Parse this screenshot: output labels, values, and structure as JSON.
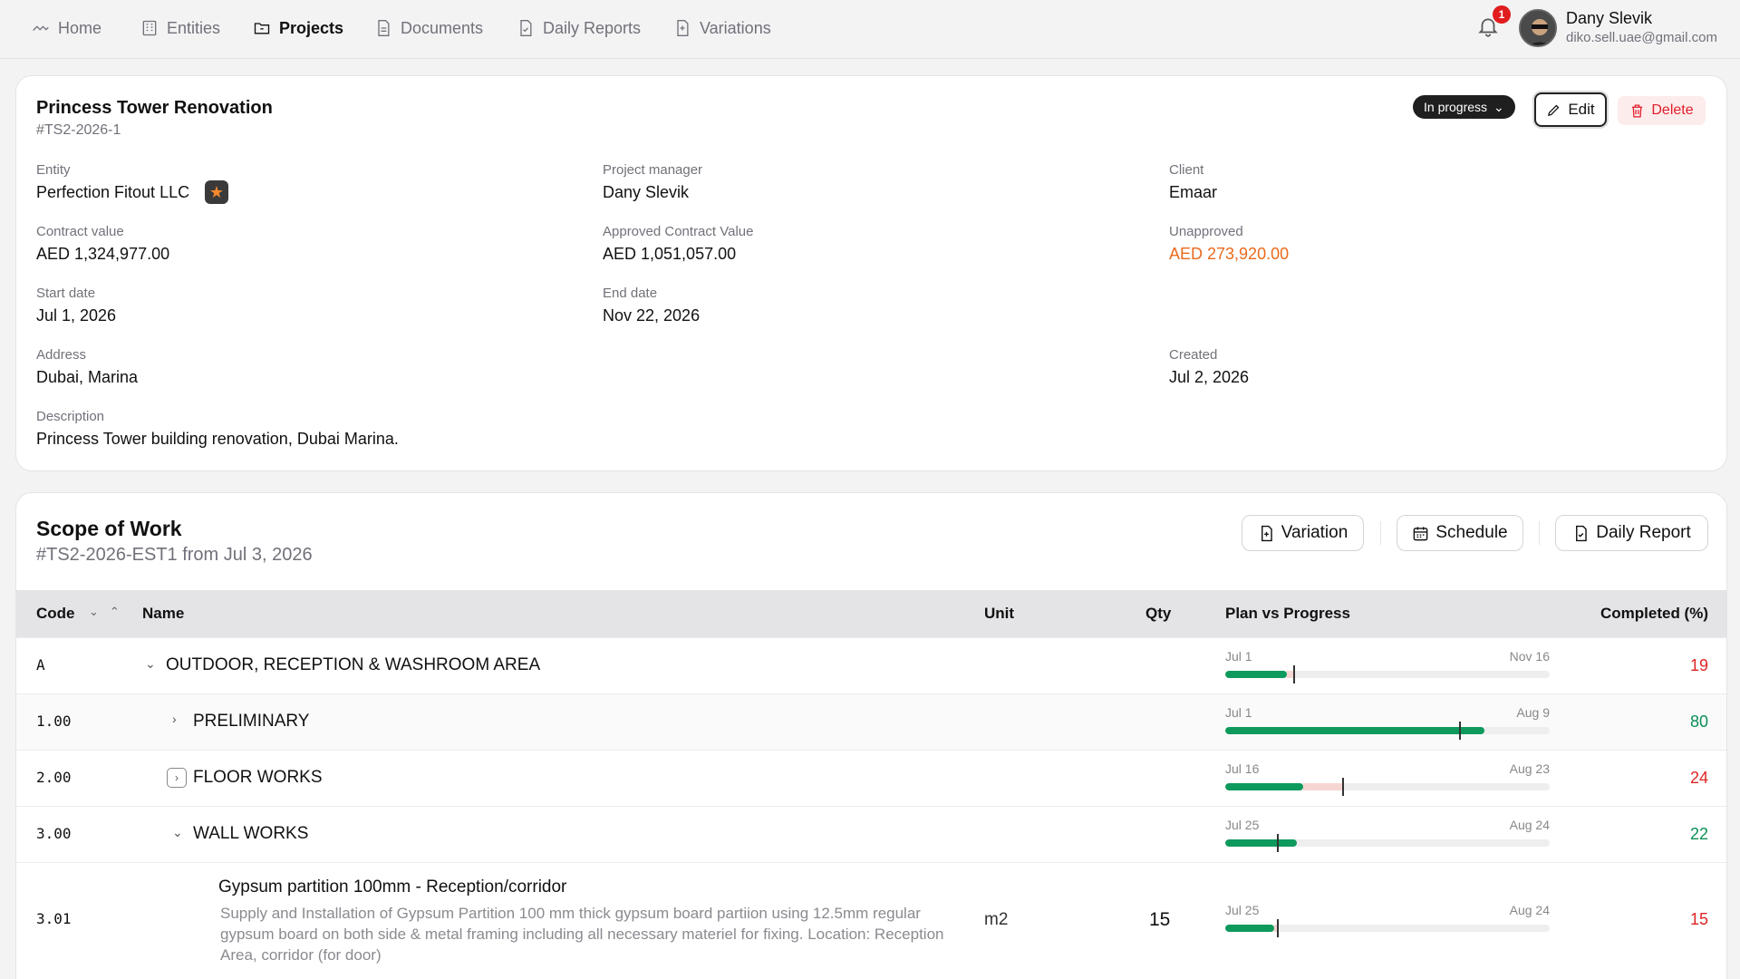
{
  "nav": {
    "items": [
      {
        "label": "Home",
        "icon": "home-icon"
      },
      {
        "label": "Entities",
        "icon": "building-icon"
      },
      {
        "label": "Projects",
        "icon": "folder-icon",
        "active": true
      },
      {
        "label": "Documents",
        "icon": "document-icon"
      },
      {
        "label": "Daily Reports",
        "icon": "report-icon"
      },
      {
        "label": "Variations",
        "icon": "variation-icon"
      }
    ],
    "notifications": "1",
    "user": {
      "name": "Dany Slevik",
      "email": "diko.sell.uae@gmail.com"
    }
  },
  "project": {
    "title": "Princess Tower Renovation",
    "code": "#TS2-2026-1",
    "status": "In progress",
    "edit_label": "Edit",
    "delete_label": "Delete",
    "fields": {
      "entity": {
        "label": "Entity",
        "value": "Perfection Fitout LLC"
      },
      "manager": {
        "label": "Project manager",
        "value": "Dany Slevik"
      },
      "client": {
        "label": "Client",
        "value": "Emaar"
      },
      "contract": {
        "label": "Contract value",
        "value": "AED 1,324,977.00"
      },
      "approved": {
        "label": "Approved Contract Value",
        "value": "AED 1,051,057.00"
      },
      "unapproved": {
        "label": "Unapproved",
        "value": "AED 273,920.00"
      },
      "start": {
        "label": "Start date",
        "value": "Jul 1, 2026"
      },
      "end": {
        "label": "End date",
        "value": "Nov 22, 2026"
      },
      "address": {
        "label": "Address",
        "value": "Dubai, Marina"
      },
      "created": {
        "label": "Created",
        "value": "Jul 2, 2026"
      },
      "description": {
        "label": "Description",
        "value": "Princess Tower building renovation, Dubai Marina."
      }
    }
  },
  "scope": {
    "title": "Scope of Work",
    "subtitle": "#TS2-2026-EST1 from Jul 3, 2026",
    "buttons": {
      "variation": "Variation",
      "schedule": "Schedule",
      "daily_report": "Daily Report"
    },
    "columns": {
      "code": "Code",
      "name": "Name",
      "unit": "Unit",
      "qty": "Qty",
      "plan": "Plan vs Progress",
      "completed": "Completed (%)"
    },
    "rows": [
      {
        "code": "A",
        "name": "OUTDOOR, RECEPTION & WASHROOM AREA",
        "start": "Jul 1",
        "end": "Nov 16",
        "progress": 0.19,
        "plan": 0.21,
        "completed": "19",
        "status": "red"
      },
      {
        "code": "1.00",
        "name": "PRELIMINARY",
        "start": "Jul 1",
        "end": "Aug 9",
        "progress": 0.8,
        "plan": 0.72,
        "completed": "80",
        "status": "green"
      },
      {
        "code": "2.00",
        "name": "FLOOR WORKS",
        "start": "Jul 16",
        "end": "Aug 23",
        "progress": 0.24,
        "plan": 0.36,
        "completed": "24",
        "status": "red"
      },
      {
        "code": "3.00",
        "name": "WALL WORKS",
        "start": "Jul 25",
        "end": "Aug 24",
        "progress": 0.22,
        "plan": 0.16,
        "completed": "22",
        "status": "green"
      },
      {
        "code": "3.01",
        "name": "Gypsum partition 100mm - Reception/corridor",
        "description": "Supply and Installation of Gypsum Partition 100 mm thick gypsum board partiion using 12.5mm regular gypsum board on both side & metal framing including all necessary materiel for fixing. Location: Reception Area, corridor (for door)",
        "unit": "m2",
        "qty": "15",
        "start": "Jul 25",
        "end": "Aug 24",
        "progress": 0.15,
        "plan": 0.16,
        "completed": "15",
        "status": "red"
      }
    ]
  }
}
